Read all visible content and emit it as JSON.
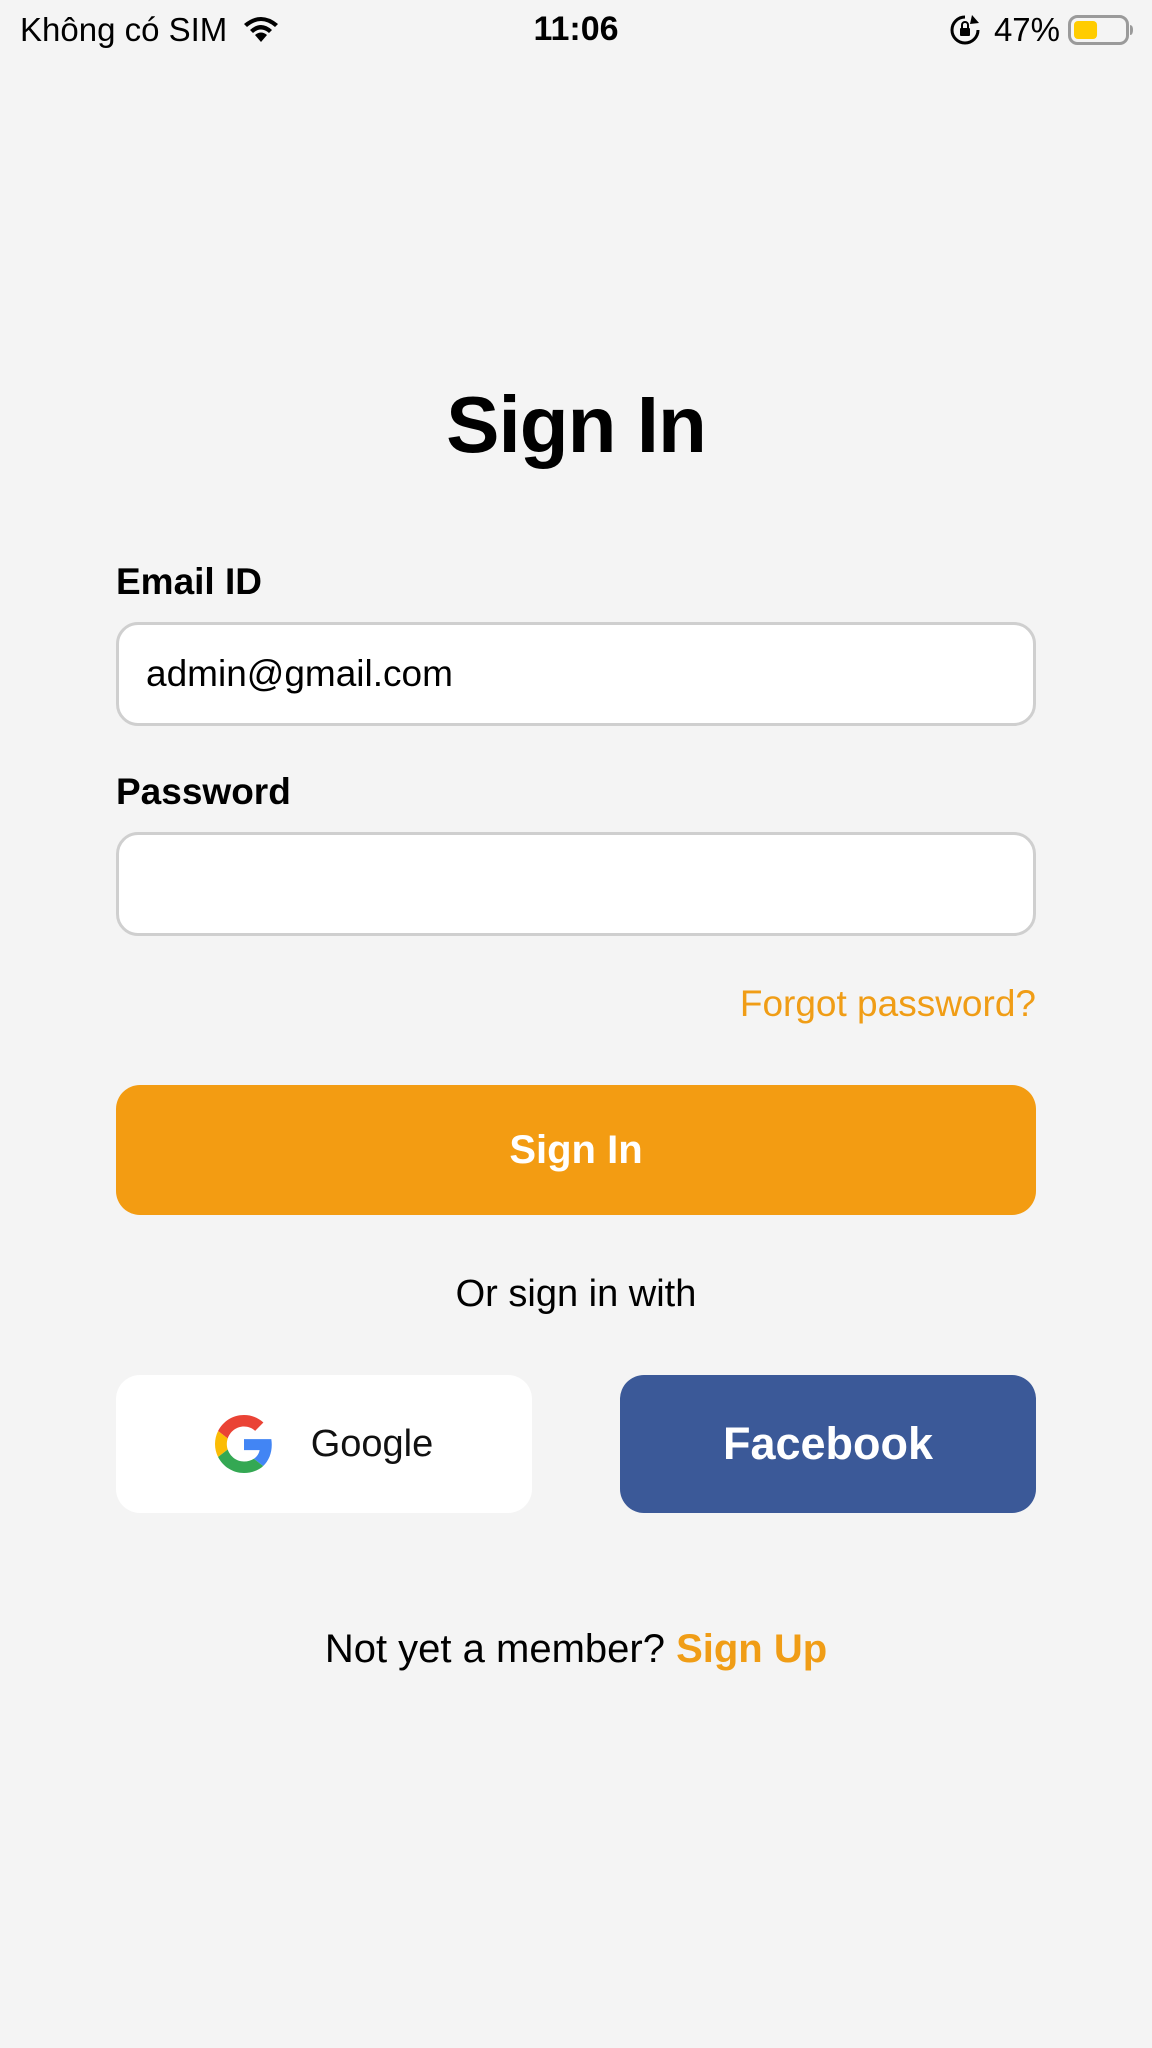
{
  "status_bar": {
    "carrier": "Không có SIM",
    "time": "11:06",
    "battery_percent": "47%",
    "battery_level": 0.47
  },
  "page": {
    "title": "Sign In"
  },
  "form": {
    "email_label": "Email ID",
    "email_value": "admin@gmail.com",
    "password_label": "Password",
    "password_value": "",
    "forgot_label": "Forgot password?",
    "submit_label": "Sign In"
  },
  "social": {
    "or_text": "Or sign in with",
    "google_label": "Google",
    "facebook_label": "Facebook"
  },
  "signup": {
    "prompt": "Not yet a member?",
    "link_label": "Sign Up"
  },
  "colors": {
    "accent": "#f39c12",
    "facebook": "#3b5998",
    "background": "#f4f4f4"
  },
  "icons": [
    "wifi-icon",
    "lock-rotation-icon",
    "battery-icon",
    "google-icon"
  ]
}
